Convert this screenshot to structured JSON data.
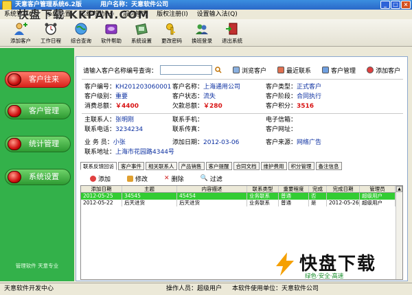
{
  "window": {
    "title": "天意客户管理系统6.2版",
    "user_label": "用户名称：天意软件公司",
    "buttons": [
      "_",
      "□",
      "×"
    ]
  },
  "watermark": "快盘下载 KKPAN.COM",
  "menu": [
    "系统管理(S)",
    "系统设置",
    "系统帮助(H)",
    "服务管理",
    "版权注册(I)",
    "设置输入法(Q)"
  ],
  "toolbar": [
    {
      "label": "添加客户",
      "icon": "add-customer-icon"
    },
    {
      "label": "工作日程",
      "icon": "alarm-clock-icon"
    },
    {
      "label": "综合查询",
      "icon": "globe-icon"
    },
    {
      "label": "软件帮助",
      "icon": "help-book-icon"
    },
    {
      "label": "系统设置",
      "icon": "settings-box-icon"
    },
    {
      "label": "更改密码",
      "icon": "key-icon"
    },
    {
      "label": "换班登录",
      "icon": "switch-user-icon"
    },
    {
      "label": "退出系统",
      "icon": "exit-door-icon"
    }
  ],
  "sidebar": {
    "items": [
      {
        "label": "客户往来"
      },
      {
        "label": "客户管理"
      },
      {
        "label": "统计管理"
      },
      {
        "label": "系统设置"
      }
    ],
    "footer": "管理软件 天意专业"
  },
  "search": {
    "label": "请输入客户名称编号查询：",
    "value": "",
    "buttons": [
      "浏览客户",
      "最近联系",
      "客户管理",
      "添加客户"
    ]
  },
  "customer": {
    "id_label": "客户编号：",
    "id": "KH201203060001",
    "name_label": "客户名称：",
    "name": "上海通用公司",
    "type_label": "客户类型：",
    "type": "正式客户",
    "level_label": "客户级别：",
    "level": "重要",
    "state_label": "客户状态：",
    "state": "流失",
    "stage_label": "客户阶段：",
    "stage": "合同执行",
    "spend_label": "消费总额：",
    "spend": "￥4400",
    "owe_label": "欠款总额：",
    "owe": "￥280",
    "points_label": "客户积分：",
    "points": "3516",
    "contact_label": "主联系人：",
    "contact": "张明刚",
    "mobile_label": "联系手机：",
    "mobile": "",
    "email_label": "电子信箱：",
    "email": "",
    "phone_label": "联系电话：",
    "phone": "3234234",
    "fax_label": "联系传真：",
    "fax": "",
    "web_label": "客户网址：",
    "web": "",
    "sales_label": "业 务 员：",
    "sales": "小张",
    "date_label": "添加日期：",
    "date": "2012-03-06",
    "source_label": "客户来源：",
    "source": "网络广告",
    "addr_label": "联系地址：",
    "addr": "上海市花园路4344号"
  },
  "tabs": [
    "联系反馈回访",
    "客户事件",
    "相关联系人",
    "产品销售",
    "客户提醒",
    "合同文档",
    "维护费用",
    "积分管理",
    "备注信息"
  ],
  "gridtools": [
    "添加",
    "修改",
    "删除",
    "过滤"
  ],
  "grid": {
    "headers": [
      "添加日期",
      "主题",
      "内容描述",
      "联系类型",
      "重要程度",
      "完成",
      "完成日期",
      "管理员"
    ],
    "rows": [
      [
        "2012-05-25",
        "34545",
        "45454",
        "业务联系",
        "普通",
        "否",
        "",
        "超级用户"
      ],
      [
        "2012-05-22",
        "后天进货",
        "后天进货",
        "业务联系",
        "普通",
        "是",
        "2012-05-26",
        "超级用户"
      ]
    ]
  },
  "status": {
    "left": "天意软件开发中心",
    "operator": "操作人员：超级用户",
    "unit": "本软件使用单位：天意软件公司"
  },
  "logo": {
    "big": "快盘下载",
    "small": "绿色·安全·高速"
  },
  "colors": {
    "accent": "#33b14a",
    "active": "#d8221a",
    "link": "#0b2fa0",
    "money": "#d81212"
  }
}
